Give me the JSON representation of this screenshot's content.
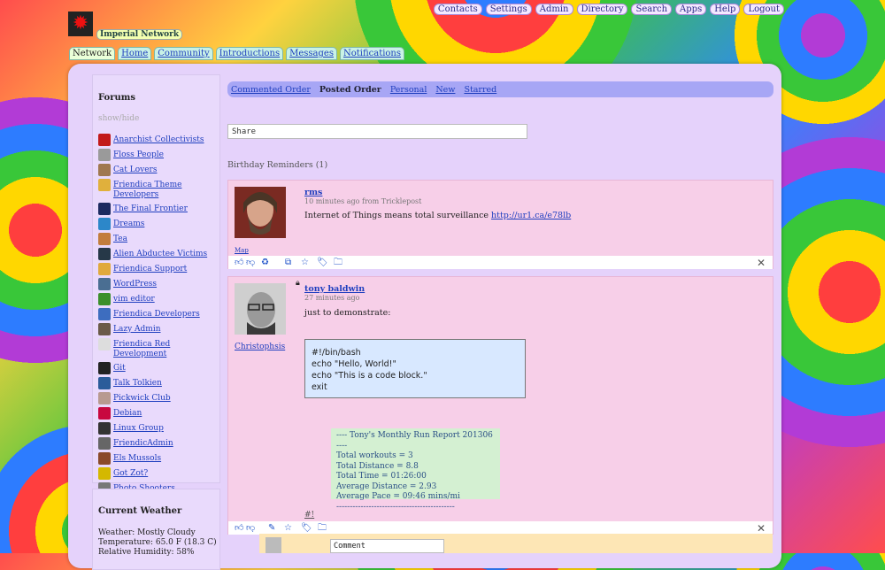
{
  "top_nav": [
    "Contacts",
    "Settings",
    "Admin",
    "Directory",
    "Search",
    "Apps",
    "Help",
    "Logout"
  ],
  "site": {
    "name": "Imperial Network"
  },
  "main_nav": [
    "Network",
    "Home",
    "Community",
    "Introductions",
    "Messages",
    "Notifications"
  ],
  "aside": {
    "forums_title": "Forums",
    "show_hide": "show/hide",
    "forums": [
      {
        "label": "Anarchist Collectivists",
        "color": "#c21a1a"
      },
      {
        "label": "Floss People",
        "color": "#9a9a9a"
      },
      {
        "label": "Cat Lovers",
        "color": "#a07850"
      },
      {
        "label": "Friendica Theme Developers",
        "color": "#e0b03c"
      },
      {
        "label": "The Final Frontier",
        "color": "#1c2a60"
      },
      {
        "label": "Dreams",
        "color": "#2c87c9"
      },
      {
        "label": "Tea",
        "color": "#c27d3c"
      },
      {
        "label": "Alien Abductee Victims",
        "color": "#263848"
      },
      {
        "label": "Friendica Support",
        "color": "#e0a93c"
      },
      {
        "label": "WordPress",
        "color": "#4a6e92"
      },
      {
        "label": "vim editor",
        "color": "#3b8f2b"
      },
      {
        "label": "Friendica Developers",
        "color": "#3d6dbf"
      },
      {
        "label": "Lazy Admin",
        "color": "#6a5a48"
      },
      {
        "label": "Friendica Red Development",
        "color": "#dddddd"
      },
      {
        "label": "Git",
        "color": "#222222"
      },
      {
        "label": "Talk Tolkien",
        "color": "#2b5c9a"
      },
      {
        "label": "Pickwick Club",
        "color": "#b89a90"
      },
      {
        "label": "Debian",
        "color": "#c8083f"
      },
      {
        "label": "Linux Group",
        "color": "#333333"
      },
      {
        "label": "FriendicAdmin",
        "color": "#666666"
      },
      {
        "label": "Els Mussols",
        "color": "#8a4a2a"
      },
      {
        "label": "Got Zot?",
        "color": "#d4b800"
      },
      {
        "label": "Photo Shooters",
        "color": "#777777"
      }
    ],
    "weather": {
      "title": "Current Weather",
      "weather": "Weather: Mostly Cloudy",
      "temperature": "Temperature: 65.0 F (18.3 C)",
      "humidity": "Relative Humidity: 58%"
    }
  },
  "tabs": [
    {
      "label": "Commented Order",
      "selected": false
    },
    {
      "label": "Posted Order",
      "selected": true
    },
    {
      "label": "Personal",
      "selected": false
    },
    {
      "label": "New",
      "selected": false
    },
    {
      "label": "Starred",
      "selected": false
    }
  ],
  "share_placeholder": "Share",
  "birthday_reminders": "Birthday Reminders (1)",
  "posts": [
    {
      "author": "rms",
      "meta": "10 minutes ago from Tricklepost",
      "text": "Internet of Things means total surveillance ",
      "link": "http://ur1.ca/e78lb",
      "map_label": "Map"
    },
    {
      "author": "tony baldwin",
      "meta": "27 minutes ago",
      "text": "just to demonstrate:",
      "owner_label": "Christophsis",
      "code_lines": [
        "#!/bin/bash",
        "echo \"Hello, World!\"",
        "echo \"This is a code block.\"",
        "exit"
      ],
      "report_lines": [
        "---- Tony's Monthly Run Report 201306 ----",
        "Total workouts = 3",
        "Total Distance = 8.8",
        "Total Time = 01:26:00",
        "Average Distance = 2.93",
        "Average Pace = 09:46 mins/mi",
        "--------------------------------------------"
      ],
      "tag": "#!",
      "comment_placeholder": "Comment"
    }
  ]
}
